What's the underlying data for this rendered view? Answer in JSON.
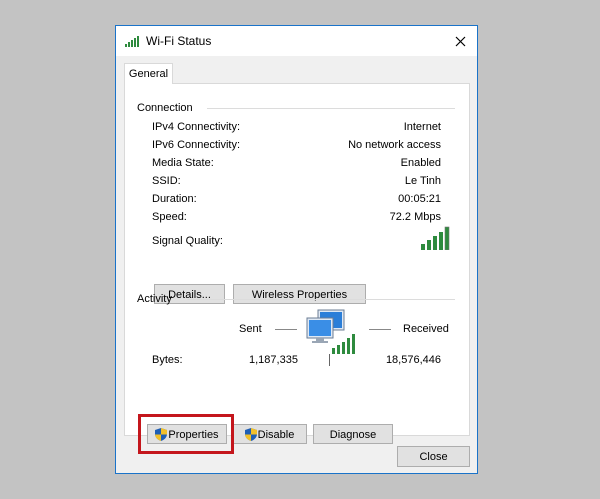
{
  "window": {
    "title": "Wi-Fi Status"
  },
  "tab": {
    "label": "General"
  },
  "connection": {
    "heading": "Connection",
    "rows": [
      {
        "label": "IPv4 Connectivity:",
        "value": "Internet"
      },
      {
        "label": "IPv6 Connectivity:",
        "value": "No network access"
      },
      {
        "label": "Media State:",
        "value": "Enabled"
      },
      {
        "label": "SSID:",
        "value": "Le Tinh"
      },
      {
        "label": "Duration:",
        "value": "00:05:21"
      },
      {
        "label": "Speed:",
        "value": "72.2 Mbps"
      }
    ],
    "signal_label": "Signal Quality:",
    "details_button": "Details...",
    "wireless_button": "Wireless Properties"
  },
  "activity": {
    "heading": "Activity",
    "sent_label": "Sent",
    "received_label": "Received",
    "bytes_label": "Bytes:",
    "bytes_sent": "1,187,335",
    "bytes_received": "18,576,446"
  },
  "buttons": {
    "properties": "Properties",
    "disable": "Disable",
    "diagnose": "Diagnose",
    "close": "Close"
  },
  "colors": {
    "signal": "#2e8b3e",
    "highlight": "#c4161c",
    "accent": "#1a73c9"
  },
  "icons": {
    "title": "wifi-signal-icon",
    "shield": "uac-shield-icon",
    "network": "network-computers-icon"
  }
}
